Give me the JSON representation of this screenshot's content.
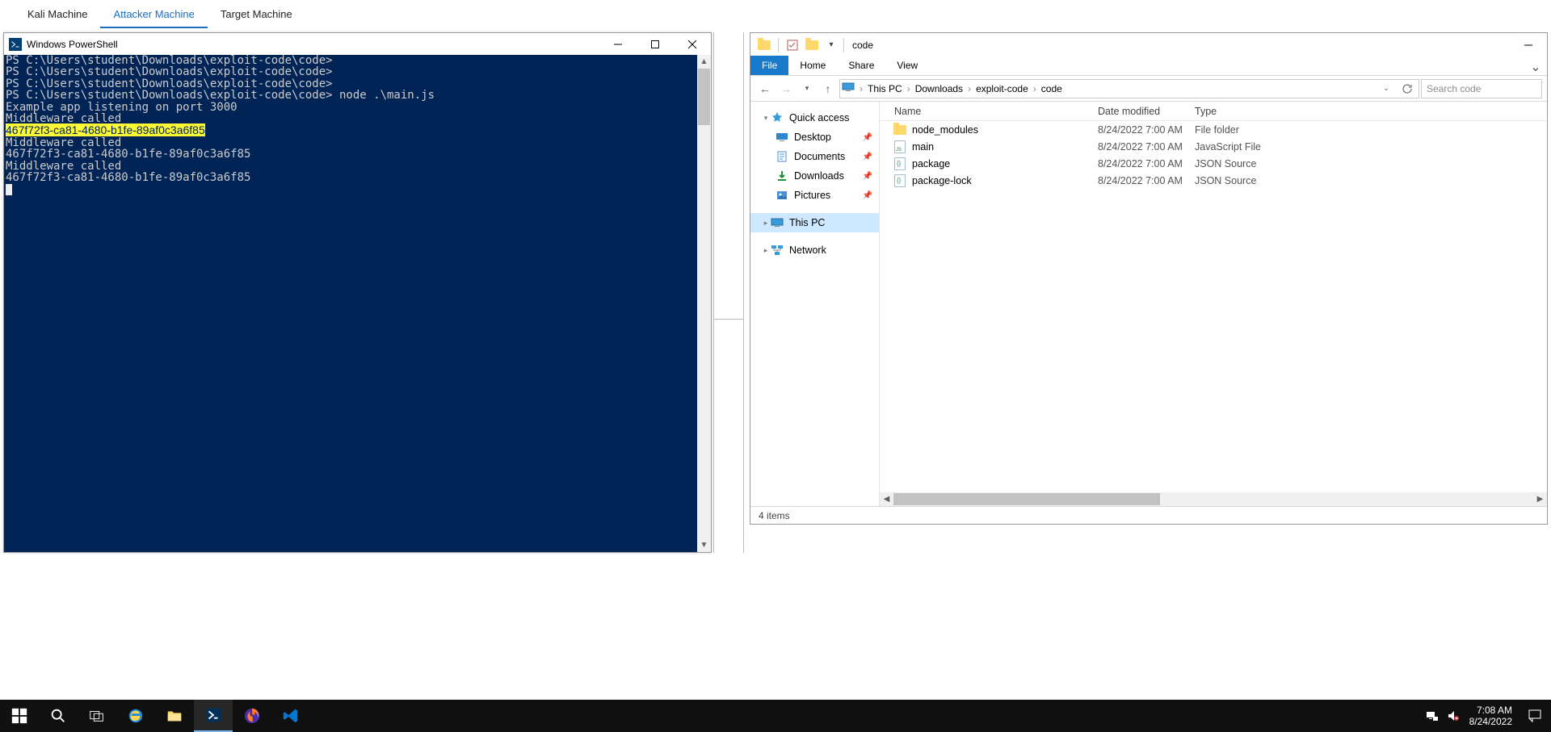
{
  "tabs": {
    "items": [
      "Kali Machine",
      "Attacker Machine",
      "Target Machine"
    ],
    "active_index": 1
  },
  "powershell": {
    "title": "Windows PowerShell",
    "lines": [
      {
        "t": "PS C:\\Users\\student\\Downloads\\exploit-code\\code>"
      },
      {
        "t": "PS C:\\Users\\student\\Downloads\\exploit-code\\code>"
      },
      {
        "t": "PS C:\\Users\\student\\Downloads\\exploit-code\\code>"
      },
      {
        "t": "PS C:\\Users\\student\\Downloads\\exploit-code\\code> node .\\main.js"
      },
      {
        "t": "Example app listening on port 3000"
      },
      {
        "t": "Middleware called"
      },
      {
        "t": "467f72f3-ca81-4680-b1fe-89af0c3a6f85",
        "hl": true
      },
      {
        "t": "Middleware called"
      },
      {
        "t": "467f72f3-ca81-4680-b1fe-89af0c3a6f85"
      },
      {
        "t": "Middleware called"
      },
      {
        "t": "467f72f3-ca81-4680-b1fe-89af0c3a6f85"
      }
    ]
  },
  "explorer": {
    "title": "code",
    "ribbon_tabs": {
      "file": "File",
      "others": [
        "Home",
        "Share",
        "View"
      ]
    },
    "breadcrumb": [
      "This PC",
      "Downloads",
      "exploit-code",
      "code"
    ],
    "search_placeholder": "Search code",
    "nav": {
      "quick_access": "Quick access",
      "quick_items": [
        "Desktop",
        "Documents",
        "Downloads",
        "Pictures"
      ],
      "this_pc": "This PC",
      "network": "Network"
    },
    "columns": {
      "name": "Name",
      "date": "Date modified",
      "type": "Type"
    },
    "rows": [
      {
        "name": "node_modules",
        "date": "8/24/2022 7:00 AM",
        "type": "File folder",
        "kind": "folder"
      },
      {
        "name": "main",
        "date": "8/24/2022 7:00 AM",
        "type": "JavaScript File",
        "kind": "js"
      },
      {
        "name": "package",
        "date": "8/24/2022 7:00 AM",
        "type": "JSON Source",
        "kind": "json"
      },
      {
        "name": "package-lock",
        "date": "8/24/2022 7:00 AM",
        "type": "JSON Source",
        "kind": "json"
      }
    ],
    "status": "4 items"
  },
  "taskbar": {
    "time": "7:08 AM",
    "date": "8/24/2022"
  }
}
